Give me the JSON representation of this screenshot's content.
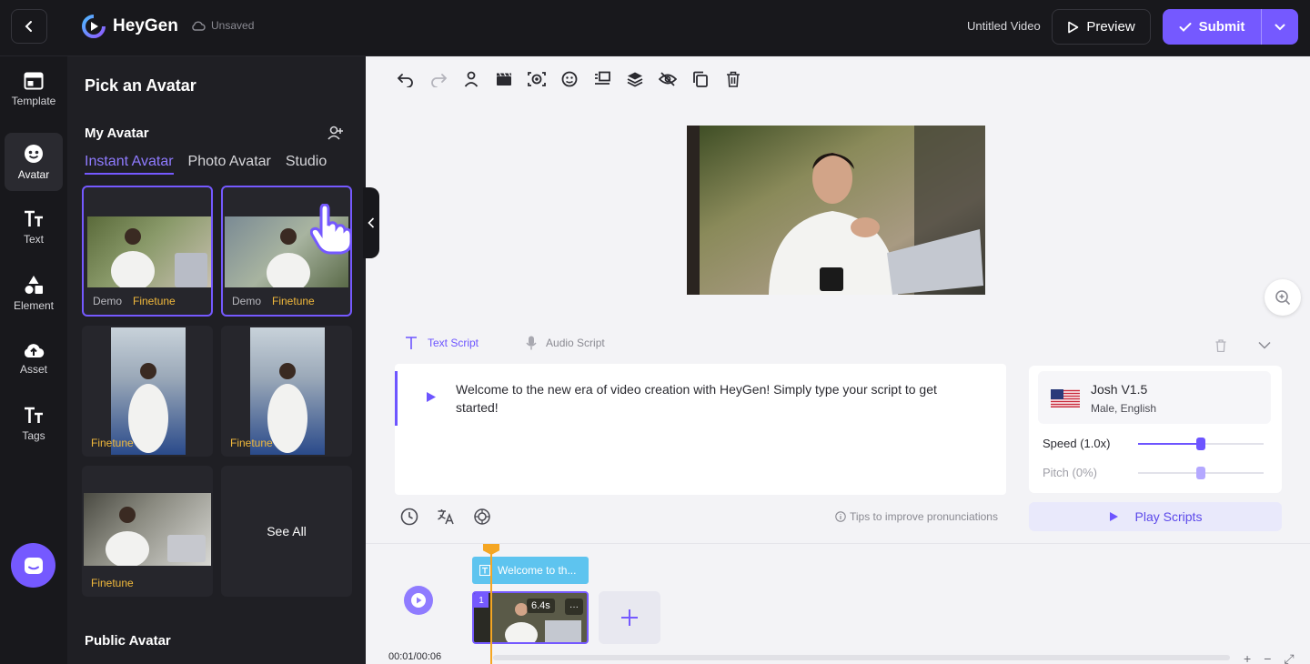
{
  "header": {
    "app_name": "HeyGen",
    "save_status": "Unsaved",
    "video_title": "Untitled Video",
    "preview_label": "Preview",
    "submit_label": "Submit"
  },
  "rail": {
    "items": [
      {
        "label": "Template",
        "icon": "template-icon"
      },
      {
        "label": "Avatar",
        "icon": "avatar-icon"
      },
      {
        "label": "Text",
        "icon": "text-icon"
      },
      {
        "label": "Element",
        "icon": "element-icon"
      },
      {
        "label": "Asset",
        "icon": "asset-icon"
      },
      {
        "label": "Tags",
        "icon": "tags-icon"
      }
    ]
  },
  "panel": {
    "title": "Pick an Avatar",
    "my_avatar": "My Avatar",
    "tabs": [
      "Instant Avatar",
      "Photo Avatar",
      "Studio"
    ],
    "cards": [
      {
        "demo": "Demo",
        "finetune": "Finetune"
      },
      {
        "demo": "Demo",
        "finetune": "Finetune"
      },
      {
        "finetune": "Finetune"
      },
      {
        "finetune": "Finetune"
      },
      {
        "finetune": "Finetune"
      }
    ],
    "see_all": "See All",
    "public_avatar": "Public Avatar"
  },
  "script": {
    "tab_text": "Text Script",
    "tab_audio": "Audio Script",
    "content": "Welcome to the new era of video creation with HeyGen! Simply type your script to get started!",
    "tips": "Tips to improve pronunciations"
  },
  "voice": {
    "name": "Josh V1.5",
    "meta": "Male, English",
    "speed_label": "Speed (1.0x)",
    "speed_fraction": 0.5,
    "pitch_label": "Pitch (0%)",
    "pitch_fraction": 0.5,
    "play_label": "Play Scripts"
  },
  "timeline": {
    "text_clip": "Welcome to th...",
    "clip_number": "1",
    "clip_duration": "6.4s",
    "clip_more": "···",
    "time": "00:01/00:06"
  },
  "colors": {
    "accent": "#7559ff",
    "text_clip": "#5ec4ef",
    "playhead": "#f5a623",
    "finetune_tag": "#f1b93c"
  }
}
